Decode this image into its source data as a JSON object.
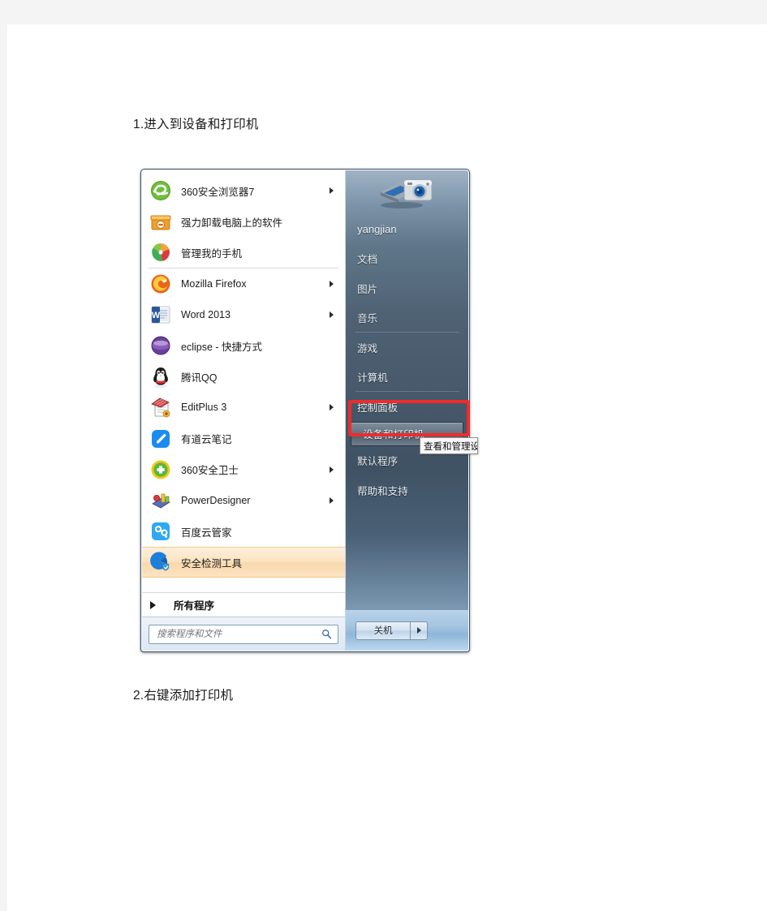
{
  "document": {
    "caption_1": "1.进入到设备和打印机",
    "caption_2": "2.右键添加打印机"
  },
  "start_menu": {
    "programs": [
      {
        "label": "360安全浏览器7",
        "icon": "ie-360-browser-icon",
        "has_submenu": true,
        "divider_after": false
      },
      {
        "label": "强力卸载电脑上的软件",
        "icon": "uninstaller-icon",
        "has_submenu": false,
        "divider_after": false
      },
      {
        "label": "管理我的手机",
        "icon": "phone-manager-icon",
        "has_submenu": false,
        "divider_after": true
      },
      {
        "label": "Mozilla Firefox",
        "icon": "firefox-icon",
        "has_submenu": true,
        "divider_after": false
      },
      {
        "label": "Word 2013",
        "icon": "word-icon",
        "has_submenu": true,
        "divider_after": false
      },
      {
        "label": "eclipse - 快捷方式",
        "icon": "eclipse-icon",
        "has_submenu": false,
        "divider_after": false
      },
      {
        "label": "腾讯QQ",
        "icon": "qq-penguin-icon",
        "has_submenu": false,
        "divider_after": false
      },
      {
        "label": "EditPlus 3",
        "icon": "editplus-icon",
        "has_submenu": true,
        "divider_after": false
      },
      {
        "label": "有道云笔记",
        "icon": "youdao-note-icon",
        "has_submenu": false,
        "divider_after": false
      },
      {
        "label": "360安全卫士",
        "icon": "360-guard-icon",
        "has_submenu": true,
        "divider_after": false
      },
      {
        "label": "PowerDesigner",
        "icon": "powerdesigner-icon",
        "has_submenu": true,
        "divider_after": false
      },
      {
        "label": "百度云管家",
        "icon": "baidu-cloud-icon",
        "has_submenu": false,
        "divider_after": false
      },
      {
        "label": "安全检测工具",
        "icon": "security-check-icon",
        "has_submenu": false,
        "divider_after": false,
        "selected": true
      }
    ],
    "all_programs_label": "所有程序",
    "search": {
      "placeholder": "搜索程序和文件",
      "value": "",
      "icon": "search-icon"
    },
    "right_panel": {
      "user_name": "yangjian",
      "avatar_icon": "camera-scanner-avatar",
      "items": [
        {
          "label": "文档",
          "divider_after": false
        },
        {
          "label": "图片",
          "divider_after": false
        },
        {
          "label": "音乐",
          "divider_after": true
        },
        {
          "label": "游戏",
          "divider_after": false
        },
        {
          "label": "计算机",
          "divider_after": true
        },
        {
          "label": "控制面板",
          "divider_after": false
        },
        {
          "label": "设备和打印机",
          "divider_after": false,
          "highlighted": true
        },
        {
          "label": "默认程序",
          "divider_after": false
        },
        {
          "label": "帮助和支持",
          "divider_after": false
        }
      ]
    },
    "shutdown": {
      "label": "关机",
      "arrow_icon": "chevron-right-icon"
    },
    "tooltip": {
      "text": "查看和管理设备、打印机和打印作业"
    }
  },
  "annotation": {
    "highlight_color": "#ef2b2b"
  }
}
